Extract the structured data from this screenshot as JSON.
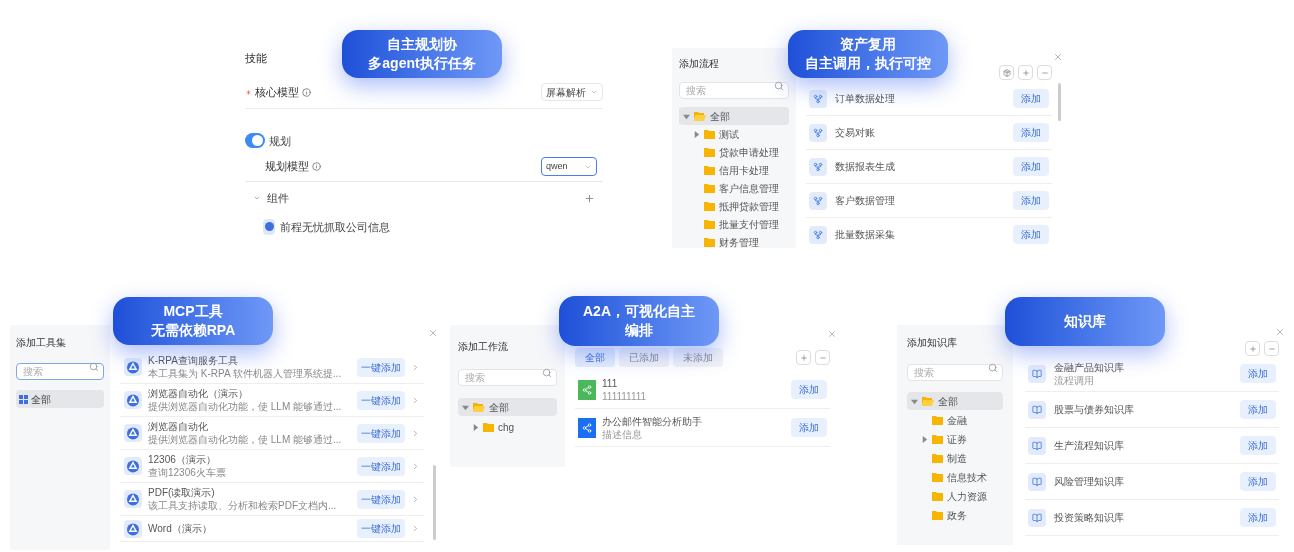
{
  "skills": {
    "callout": [
      "自主规划协",
      "多agent执行任务"
    ],
    "title": "技能",
    "core_model": {
      "label": "核心模型",
      "required": true,
      "value": "屏幕解析",
      "focused": false
    },
    "planning": {
      "label": "规划",
      "on": true
    },
    "planning_model": {
      "label": "规划模型",
      "value": "qwen",
      "focused": true
    },
    "components": {
      "label": "组件",
      "expanded": true,
      "items": [
        "前程无忧抓取公司信息"
      ]
    }
  },
  "flows": {
    "callout": [
      "资产复用",
      "自主调用，执行可控"
    ],
    "title": "添加流程",
    "search_placeholder": "搜索",
    "tree": [
      {
        "label": "全部",
        "expandable": true,
        "expanded": true,
        "selected": true,
        "children": [
          {
            "label": "测试",
            "expandable": true,
            "expanded": false,
            "selected": false
          },
          {
            "label": "贷款申请处理",
            "expandable": false,
            "selected": false
          },
          {
            "label": "信用卡处理",
            "expandable": false,
            "selected": false
          },
          {
            "label": "客户信息管理",
            "expandable": false,
            "selected": false
          },
          {
            "label": "抵押贷款管理",
            "expandable": false,
            "selected": false
          },
          {
            "label": "批量支付管理",
            "expandable": false,
            "selected": false
          },
          {
            "label": "财务管理",
            "expandable": false,
            "selected": false
          }
        ]
      }
    ],
    "items": [
      {
        "name": "订单数据处理",
        "action": "添加"
      },
      {
        "name": "交易对账",
        "action": "添加"
      },
      {
        "name": "数据报表生成",
        "action": "添加"
      },
      {
        "name": "客户数据管理",
        "action": "添加"
      },
      {
        "name": "批量数据采集",
        "action": "添加"
      }
    ]
  },
  "toolsets": {
    "callout": [
      "MCP工具",
      "无需依赖RPA"
    ],
    "title": "添加工具集",
    "search_placeholder": "搜索",
    "categories": [
      {
        "label": "全部",
        "selected": true
      }
    ],
    "items": [
      {
        "name": "K-RPA查询服务工具",
        "desc": "本工具集为 K-RPA 软件机器人管理系统提...",
        "action": "一键添加"
      },
      {
        "name": "浏览器自动化（演示）",
        "desc": "提供浏览器自动化功能，使 LLM 能够通过...",
        "action": "一键添加"
      },
      {
        "name": "浏览器自动化",
        "desc": "提供浏览器自动化功能，使 LLM 能够通过...",
        "action": "一键添加"
      },
      {
        "name": "12306（演示）",
        "desc": "查询12306火车票",
        "action": "一键添加"
      },
      {
        "name": "PDF(读取演示)",
        "desc": "该工具支持读取、分析和检索PDF文档内...",
        "action": "一键添加"
      },
      {
        "name": "Word（演示）",
        "action": "一键添加"
      }
    ]
  },
  "workflows": {
    "callout": [
      "A2A，可视化自主",
      "编排"
    ],
    "title": "添加工作流",
    "search_placeholder": "搜索",
    "tree": [
      {
        "label": "全部",
        "expandable": true,
        "expanded": true,
        "selected": true,
        "children": [
          {
            "label": "chg",
            "expandable": true,
            "expanded": false,
            "selected": false
          }
        ]
      }
    ],
    "tabs": [
      {
        "label": "全部",
        "selected": true
      },
      {
        "label": "已添加",
        "selected": false
      },
      {
        "label": "未添加",
        "selected": false
      }
    ],
    "items": [
      {
        "name": "111",
        "desc": "111111111",
        "color": "#4cb85c",
        "action": "添加"
      },
      {
        "name": "办公邮件智能分析助手",
        "desc": "描述信息",
        "color": "#1d6ff2",
        "action": "添加"
      }
    ]
  },
  "knowledge": {
    "callout": [
      "知识库"
    ],
    "title": "添加知识库",
    "search_placeholder": "搜索",
    "tree": [
      {
        "label": "全部",
        "expandable": true,
        "expanded": true,
        "selected": true,
        "children": [
          {
            "label": "金融",
            "expandable": false,
            "selected": false
          },
          {
            "label": "证券",
            "expandable": true,
            "expanded": false,
            "selected": false
          },
          {
            "label": "制造",
            "expandable": false,
            "selected": false
          },
          {
            "label": "信息技术",
            "expandable": false,
            "selected": false
          },
          {
            "label": "人力资源",
            "expandable": false,
            "selected": false
          },
          {
            "label": "政务",
            "expandable": false,
            "selected": false
          }
        ]
      }
    ],
    "items": [
      {
        "name": "金融产品知识库",
        "desc": "流程调用",
        "action": "添加"
      },
      {
        "name": "股票与债券知识库",
        "action": "添加"
      },
      {
        "name": "生产流程知识库",
        "action": "添加"
      },
      {
        "name": "风险管理知识库",
        "action": "添加"
      },
      {
        "name": "投资策略知识库",
        "action": "添加"
      }
    ]
  }
}
